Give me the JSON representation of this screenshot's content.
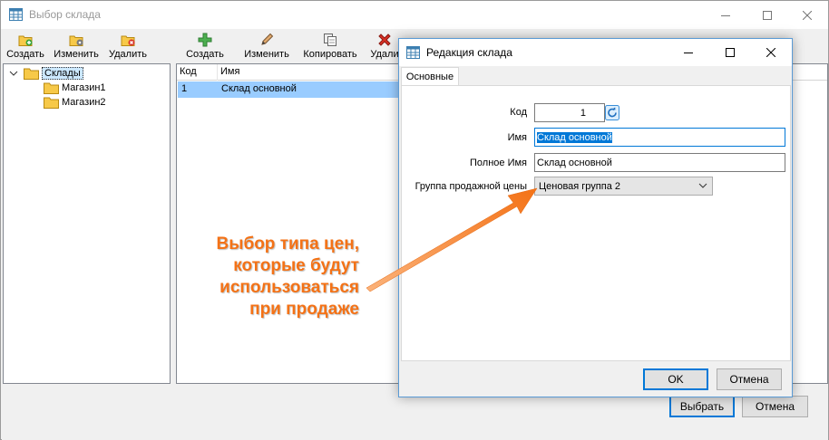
{
  "window": {
    "title": "Выбор склада"
  },
  "toolbar_left": {
    "create": "Создать",
    "edit": "Изменить",
    "delete": "Удалить"
  },
  "toolbar_right": {
    "create": "Создать",
    "edit": "Изменить",
    "copy": "Копировать",
    "delete": "Удали"
  },
  "tree": {
    "root": "Склады",
    "children": [
      "Магазин1",
      "Магазин2"
    ]
  },
  "grid": {
    "columns": [
      "Код",
      "Имя"
    ],
    "rows": [
      {
        "code": "1",
        "name": "Склад основной"
      }
    ]
  },
  "bottom_buttons": {
    "select": "Выбрать",
    "cancel": "Отмена"
  },
  "dialog": {
    "title": "Редакция склада",
    "tab": "Основные",
    "fields": {
      "code_label": "Код",
      "code_value": "1",
      "name_label": "Имя",
      "name_value": "Склад основной",
      "fullname_label": "Полное Имя",
      "fullname_value": "Склад основной",
      "price_group_label": "Группа продажной цены",
      "price_group_value": "Ценовая группа 2"
    },
    "ok": "OK",
    "cancel": "Отмена"
  },
  "annotation": {
    "line1": "Выбор типа цен,",
    "line2": "которые будут",
    "line3": "использоваться",
    "line4": "при продаже",
    "color": "#f47216"
  }
}
